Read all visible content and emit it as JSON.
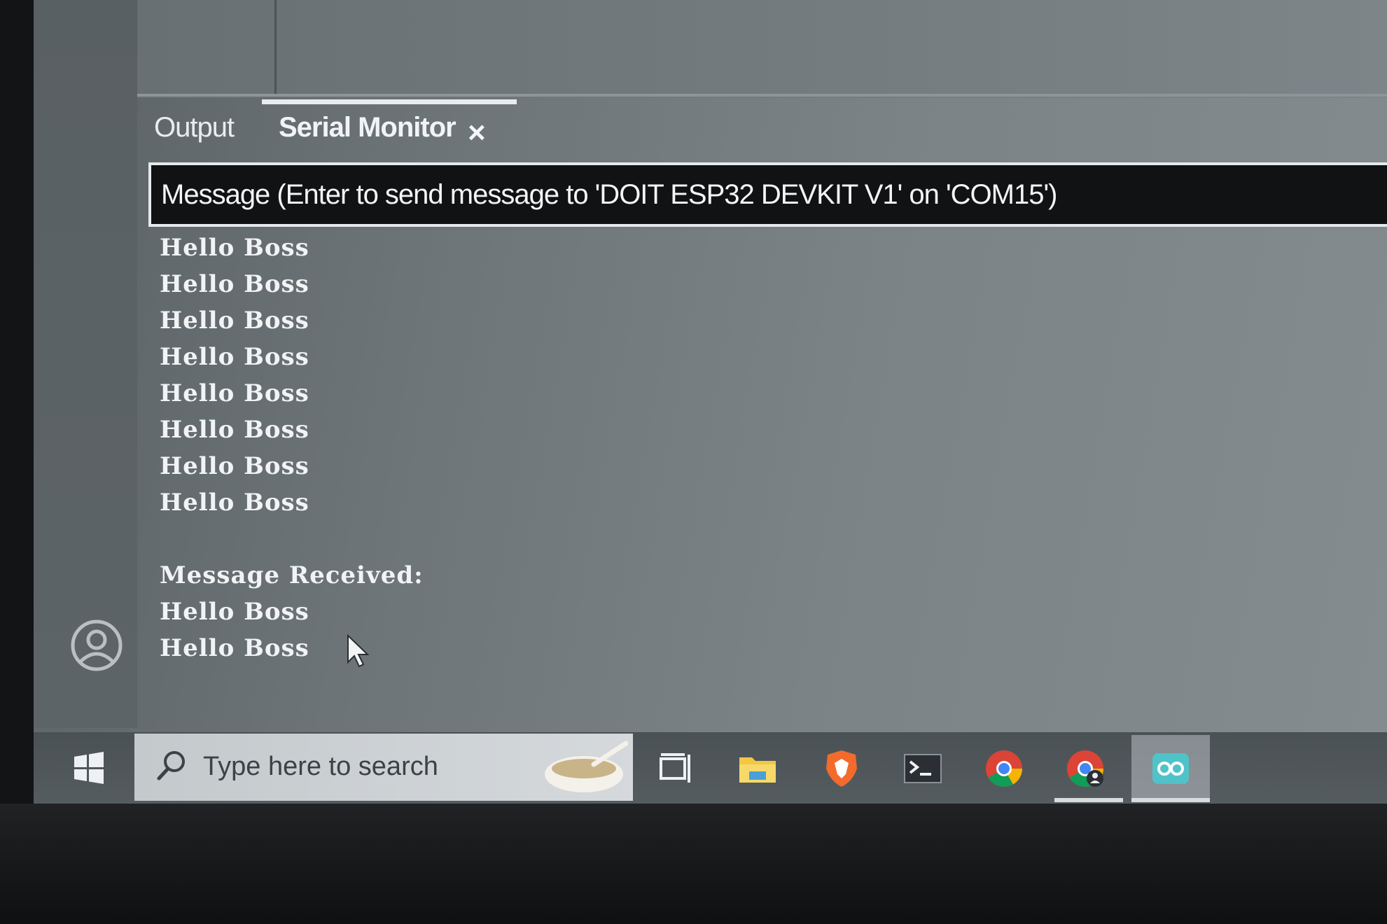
{
  "panel": {
    "tabs": [
      {
        "label": "Output"
      },
      {
        "label": "Serial Monitor"
      }
    ]
  },
  "serial_monitor": {
    "message_placeholder": "Message (Enter to send message to 'DOIT ESP32 DEVKIT V1' on 'COM15')",
    "lines": [
      "Hello Boss",
      "Hello Boss",
      "Hello Boss",
      "Hello Boss",
      "Hello Boss",
      "Hello Boss",
      "Hello Boss",
      "Hello Boss",
      "",
      "Message Received:",
      "Hello Boss",
      "Hello Boss"
    ]
  },
  "taskbar": {
    "search_placeholder": "Type here to search",
    "icons": [
      "windows-start-icon",
      "search-icon",
      "task-view-icon",
      "file-explorer-icon",
      "brave-browser-icon",
      "terminal-icon",
      "chrome-icon",
      "chrome-profile-icon",
      "arduino-ide-icon"
    ]
  },
  "colors": {
    "screen_bg": "#6d7579",
    "input_bg": "#111213",
    "text": "#f1f3f4"
  }
}
